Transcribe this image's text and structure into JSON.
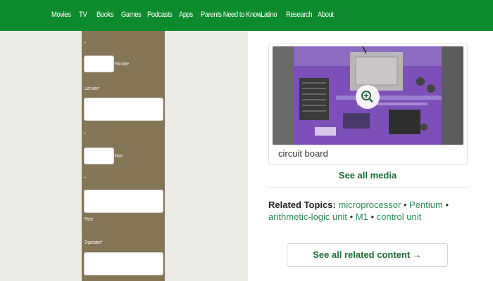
{
  "nav": {
    "items": [
      {
        "label": "Movies"
      },
      {
        "label": "TV"
      },
      {
        "label": "Books"
      },
      {
        "label": "Games"
      },
      {
        "label": "Podcasts"
      },
      {
        "label": "Apps"
      },
      {
        "label": "Parents Need to Know"
      },
      {
        "label": "Latino"
      },
      {
        "label": "Research"
      },
      {
        "label": "About"
      }
    ]
  },
  "form": {
    "first_name_label": "First name",
    "last_name_label": "Last name*",
    "email_label": "Email",
    "phone_label": "Phone",
    "organization_label": "Organization*"
  },
  "media": {
    "caption": "circuit board",
    "see_all": "See all media",
    "zoom_icon": "zoom-in-icon"
  },
  "related": {
    "heading": "Related Topics:",
    "topics": [
      "microprocessor",
      "Pentium",
      "arithmetic-logic unit",
      "M1",
      "control unit"
    ],
    "see_all_button": "See all related content →"
  },
  "colors": {
    "nav_green": "#0b8a2e",
    "form_panel": "#847555",
    "link_green": "#1b6c33"
  }
}
